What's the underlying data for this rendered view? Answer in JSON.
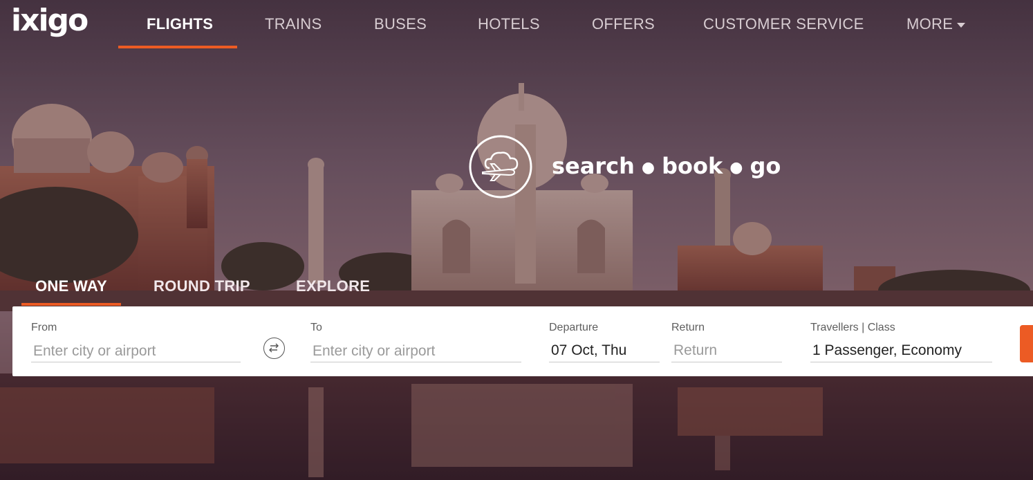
{
  "brand": {
    "logo": "ixigo",
    "accent_color": "#ec5b24"
  },
  "nav": {
    "items": [
      {
        "label": "FLIGHTS",
        "active": true
      },
      {
        "label": "TRAINS"
      },
      {
        "label": "BUSES"
      },
      {
        "label": "HOTELS"
      },
      {
        "label": "OFFERS"
      },
      {
        "label": "CUSTOMER SERVICE"
      },
      {
        "label": "MORE",
        "icon": "caret-down-icon"
      }
    ]
  },
  "hero": {
    "icon": "plane-cloud-icon",
    "tagline": [
      "search",
      "book",
      "go"
    ]
  },
  "trip_tabs": [
    {
      "label": "ONE WAY",
      "active": true
    },
    {
      "label": "ROUND TRIP"
    },
    {
      "label": "EXPLORE"
    }
  ],
  "search": {
    "from": {
      "label": "From",
      "placeholder": "Enter city or airport",
      "value": ""
    },
    "swap_icon": "swap-arrows-icon",
    "to": {
      "label": "To",
      "placeholder": "Enter city or airport",
      "value": ""
    },
    "departure": {
      "label": "Departure",
      "value": "07 Oct, Thu"
    },
    "return": {
      "label": "Return",
      "placeholder": "Return"
    },
    "travellers": {
      "label": "Travellers | Class",
      "value": "1 Passenger, Economy"
    }
  }
}
